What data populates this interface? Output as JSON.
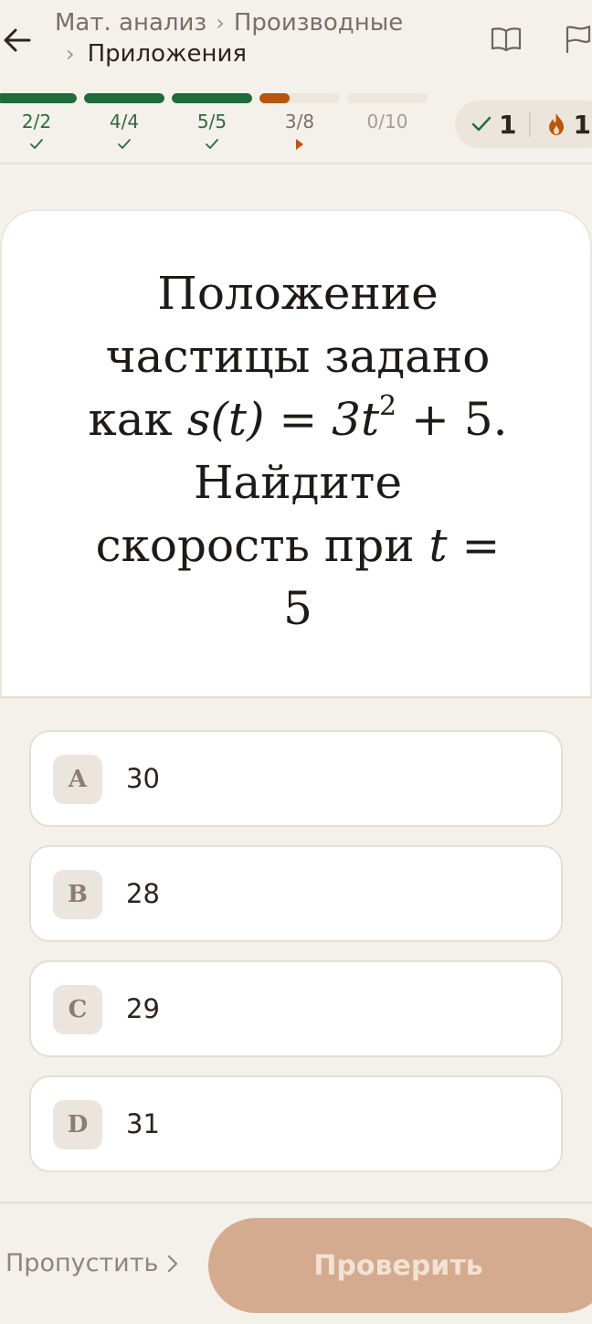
{
  "breadcrumb": {
    "level1": "Мат. анализ",
    "level2": "Производные",
    "level3": "Приложения"
  },
  "progress": {
    "segments": [
      {
        "label": "2/2",
        "done": 2,
        "total": 2,
        "state": "complete",
        "color": "#1f6b3a"
      },
      {
        "label": "4/4",
        "done": 4,
        "total": 4,
        "state": "complete",
        "color": "#1f6b3a"
      },
      {
        "label": "5/5",
        "done": 5,
        "total": 5,
        "state": "complete",
        "color": "#1f6b3a"
      },
      {
        "label": "3/8",
        "done": 3,
        "total": 8,
        "state": "current",
        "color": "#b8560f"
      },
      {
        "label": "0/10",
        "done": 0,
        "total": 10,
        "state": "empty",
        "color": "#ece6dd"
      }
    ]
  },
  "stats": {
    "correct": "1",
    "streak": "1",
    "correct_color": "#1f6b3a",
    "streak_color": "#b8560f"
  },
  "question": {
    "line1": "Положение",
    "line2": "частицы задано",
    "line3_prefix": "как",
    "line3_func": "s(t) = 3t",
    "line3_exp": "2",
    "line3_suffix": " + 5.",
    "line4": "Найдите",
    "line5_text": "скорость при",
    "line5_math": "t =",
    "line6": "5"
  },
  "options": [
    {
      "letter": "A",
      "value": "30"
    },
    {
      "letter": "B",
      "value": "28"
    },
    {
      "letter": "C",
      "value": "29"
    },
    {
      "letter": "D",
      "value": "31"
    }
  ],
  "footer": {
    "skip_label": "Пропустить",
    "check_label": "Проверить"
  },
  "colors": {
    "accent_green": "#1f6b3a",
    "accent_orange": "#b8560f",
    "button_disabled": "#d4ab8e"
  }
}
